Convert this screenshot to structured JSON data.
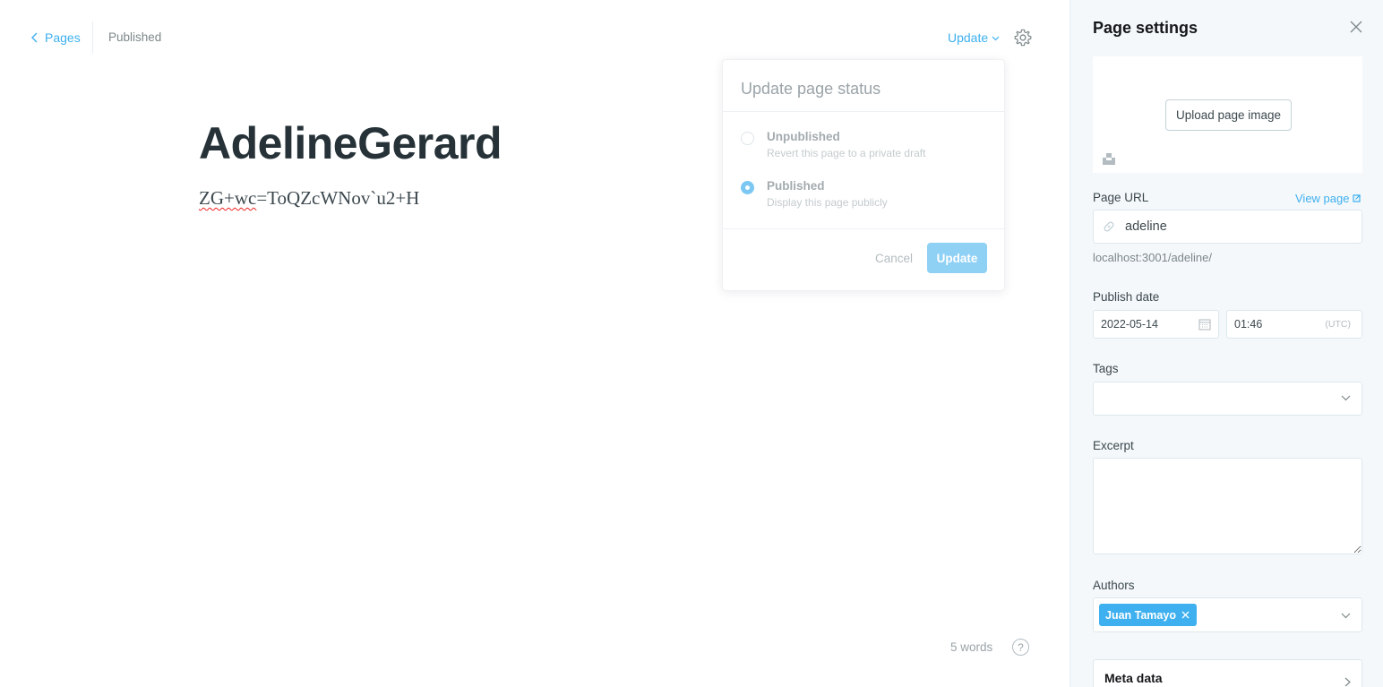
{
  "header": {
    "back_label": "Pages",
    "status": "Published",
    "update_label": "Update"
  },
  "editor": {
    "title": "AdelineGerard",
    "body_misspelled": "ZG+wc",
    "body_rest": "=ToQZcWNov`u2+H",
    "word_count": "5 words",
    "help_glyph": "?"
  },
  "publish_menu": {
    "heading": "Update page status",
    "options": [
      {
        "label": "Unpublished",
        "description": "Revert this page to a private draft",
        "selected": false
      },
      {
        "label": "Published",
        "description": "Display this page publicly",
        "selected": true
      }
    ],
    "cancel_label": "Cancel",
    "update_label": "Update"
  },
  "settings": {
    "title": "Page settings",
    "upload_image_label": "Upload page image",
    "page_url_label": "Page URL",
    "view_page_label": "View page",
    "slug": "adeline",
    "url_hint": "localhost:3001/adeline/",
    "publish_date_label": "Publish date",
    "date": "2022-05-14",
    "time": "01:46",
    "timezone": "(UTC)",
    "tags_label": "Tags",
    "excerpt_label": "Excerpt",
    "authors_label": "Authors",
    "authors": [
      "Juan Tamayo"
    ],
    "meta_label": "Meta data"
  },
  "colors": {
    "accent": "#3eb0ef",
    "panel_bg": "#f4f8fb",
    "button_disabled": "#8fd0f5"
  }
}
